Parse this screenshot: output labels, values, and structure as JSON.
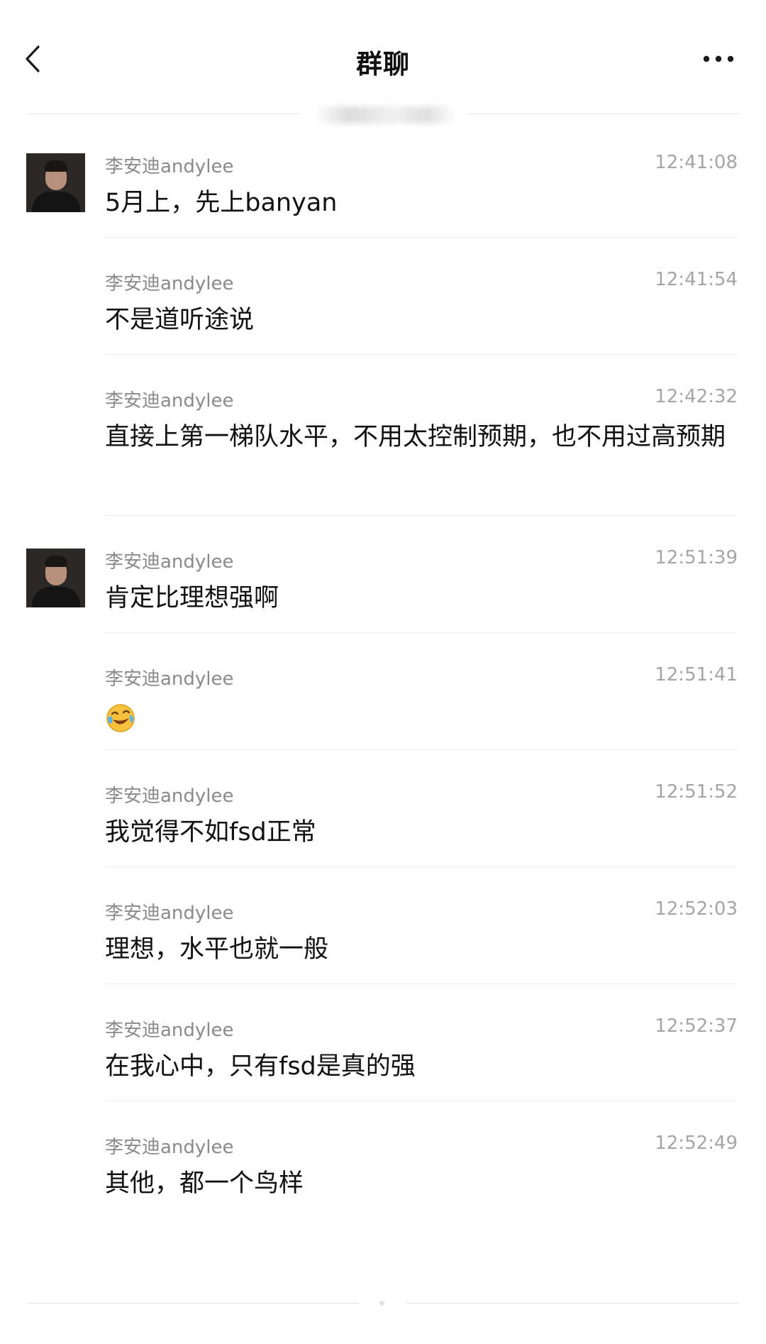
{
  "header": {
    "title": "群聊",
    "back_icon": "chevron-left-icon",
    "more_icon": "more-horizontal-icon"
  },
  "messages": [
    {
      "sender": "李安迪andylee",
      "time": "12:41:08",
      "text": "5月上，先上banyan",
      "show_avatar": true
    },
    {
      "sender": "李安迪andylee",
      "time": "12:41:54",
      "text": "不是道听途说",
      "show_avatar": false
    },
    {
      "sender": "李安迪andylee",
      "time": "12:42:32",
      "text": "直接上第一梯队水平，不用太控制预期，也不用过高预期",
      "show_avatar": false
    },
    {
      "sender": "李安迪andylee",
      "time": "12:51:39",
      "text": "肯定比理想强啊",
      "show_avatar": true
    },
    {
      "sender": "李安迪andylee",
      "time": "12:51:41",
      "text": "",
      "emoji": "laughing-tears-emoji",
      "show_avatar": false
    },
    {
      "sender": "李安迪andylee",
      "time": "12:51:52",
      "text": "我觉得不如fsd正常",
      "show_avatar": false
    },
    {
      "sender": "李安迪andylee",
      "time": "12:52:03",
      "text": "理想，水平也就一般",
      "show_avatar": false
    },
    {
      "sender": "李安迪andylee",
      "time": "12:52:37",
      "text": "在我心中，只有fsd是真的强",
      "show_avatar": false
    },
    {
      "sender": "李安迪andylee",
      "time": "12:52:49",
      "text": "其他，都一个鸟样",
      "show_avatar": false
    }
  ],
  "colors": {
    "sender": "#8a8a8a",
    "time": "#a5a5a5",
    "text": "#111111",
    "divider": "#ececec"
  }
}
